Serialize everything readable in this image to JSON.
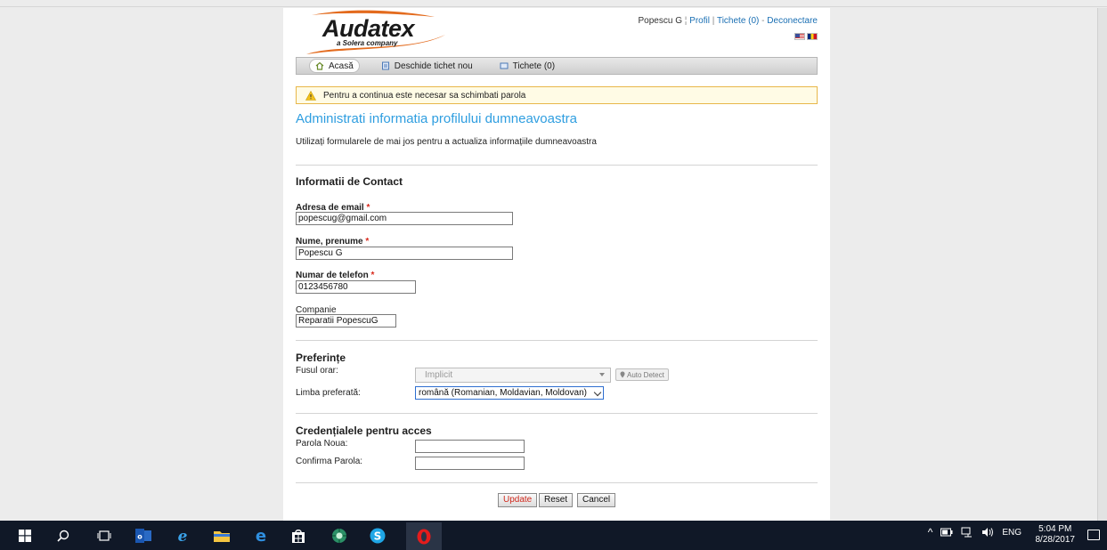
{
  "logo": {
    "title": "Audatex",
    "subtitle": "a Solera company"
  },
  "userbar": {
    "user": "Popescu G",
    "sep1": "¦",
    "profile": "Profil",
    "sep2": "|",
    "tickets": "Tichete (0)",
    "sep3": "-",
    "logout": "Deconectare"
  },
  "nav": {
    "home": "Acasă",
    "new_ticket": "Deschide tichet nou",
    "tickets": "Tichete (0)"
  },
  "warning": "Pentru a continua este necesar sa schimbati parola",
  "page": {
    "title": "Administrati informatia profilului dumneavoastra",
    "description": "Utilizați formularele de mai jos pentru a actualiza informațiile dumneavoastra"
  },
  "contact": {
    "title": "Informatii de Contact",
    "email_label": "Adresa de email",
    "email_value": "popescug@gmail.com",
    "name_label": "Nume, prenume",
    "name_value": "Popescu G",
    "phone_label": "Numar de telefon",
    "phone_value": "0123456780",
    "company_label": "Companie",
    "company_value": "Reparatii PopescuG",
    "required_mark": "*"
  },
  "preferences": {
    "title": "Preferințe",
    "timezone_label": "Fusul orar:",
    "timezone_value": "Implicit",
    "autodetect": "Auto Detect",
    "language_label": "Limba preferată:",
    "language_value": "română (Romanian, Moldavian, Moldovan)"
  },
  "credentials": {
    "title": "Credențialele pentru acces",
    "new_password_label": "Parola Noua:",
    "confirm_password_label": "Confirma Parola:"
  },
  "buttons": {
    "update": "Update",
    "reset": "Reset",
    "cancel": "Cancel"
  },
  "taskbar": {
    "lang": "ENG",
    "time": "5:04 PM",
    "date": "8/28/2017"
  },
  "colors": {
    "accent": "#2f9ee0",
    "warning_border": "#e8b74a",
    "required": "#d9291c",
    "taskbar": "#101827"
  }
}
